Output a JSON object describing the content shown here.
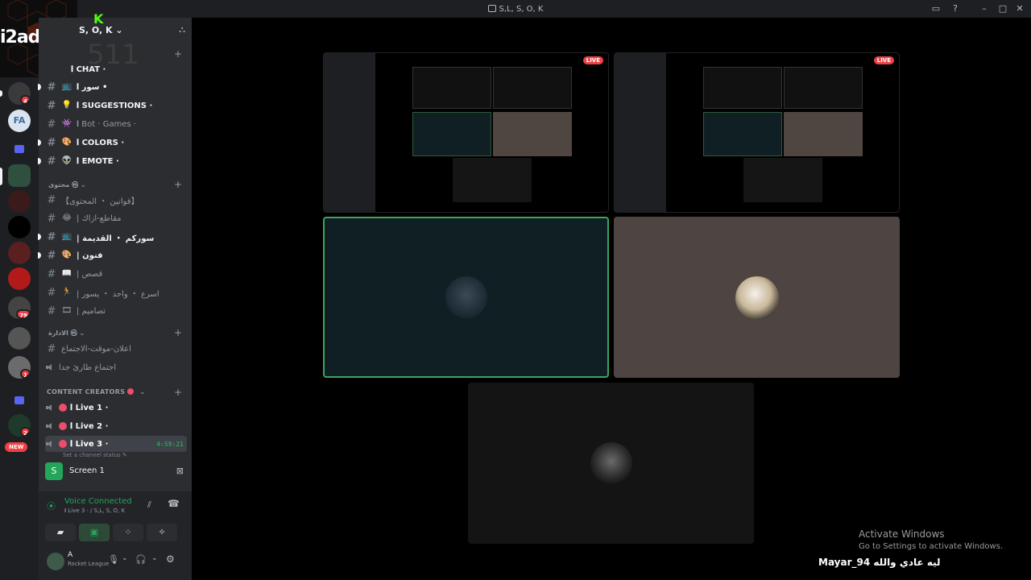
{
  "window": {
    "title": "S,L, S, O, K"
  },
  "logo": {
    "text": "i2adnar"
  },
  "server": {
    "name": "S, O, K",
    "kick_letter": "K",
    "count": "511"
  },
  "channels": {
    "chat": "𝐈 CHAT ·",
    "items": [
      {
        "label": "𝐈 سور •",
        "emoji": "📺",
        "bold": true
      },
      {
        "label": "𝐈 SUGGESTIONS ·",
        "emoji": "💡",
        "bold": false
      },
      {
        "label": "𝐈 Bot · Games ·",
        "emoji": "👾",
        "bold": false
      },
      {
        "label": "𝐈 COLORS ·",
        "emoji": "🎨",
        "bold": true
      },
      {
        "label": "𝐈 EMOTE ·",
        "emoji": "👽",
        "bold": true
      }
    ],
    "category_2": "محتوى ㉿",
    "items2": [
      {
        "label": "【قوانين ・ المحتوى】",
        "emoji": "📖"
      },
      {
        "label": "مقاطع-ازاك |",
        "emoji": "😂"
      },
      {
        "label": "سوركم ・ القديمة |",
        "emoji": "📺"
      },
      {
        "label": "فنون |",
        "emoji": "🎨"
      },
      {
        "label": "قصص |",
        "emoji": "📖"
      },
      {
        "label": "اسرع ・ واحد ・ يسور |",
        "emoji": "🏃"
      },
      {
        "label": "تصاميم |",
        "emoji": "🎞"
      }
    ],
    "category_3": "الادارة ㉿",
    "items3": [
      {
        "label": "اعلان-موقت-الاجتماع",
        "type": "text"
      },
      {
        "label": "اجتماع طارئ جدا",
        "type": "voice"
      }
    ],
    "category_4": "CONTENT CREATORS",
    "voice": [
      {
        "label": "𝐈 Live 1 ·"
      },
      {
        "label": "𝐈 Live 2 ·"
      },
      {
        "label": "𝐈 Live 3 ·",
        "timer": "4:59:21",
        "status": "Set a channel status"
      }
    ]
  },
  "screen_panel": {
    "label": "Screen 1"
  },
  "voice_panel": {
    "status": "Voice Connected",
    "channel": "𝐈 Live 3 · / S,L, S, O, K"
  },
  "user": {
    "name": "A",
    "activity": "Rocket League"
  },
  "new_badge": "NEW",
  "badges": [
    "4",
    "79",
    "1",
    "2",
    "2"
  ],
  "tiles": {
    "live_label": "LIVE"
  },
  "watermark": {
    "line1": "Activate Windows",
    "line2": "Go to Settings to activate Windows."
  },
  "caption": "Mayar_94  ليه عادي والله",
  "colors": {
    "accent_green": "#23a55a",
    "live_red": "#ed4245",
    "kick_green": "#53fc18"
  }
}
